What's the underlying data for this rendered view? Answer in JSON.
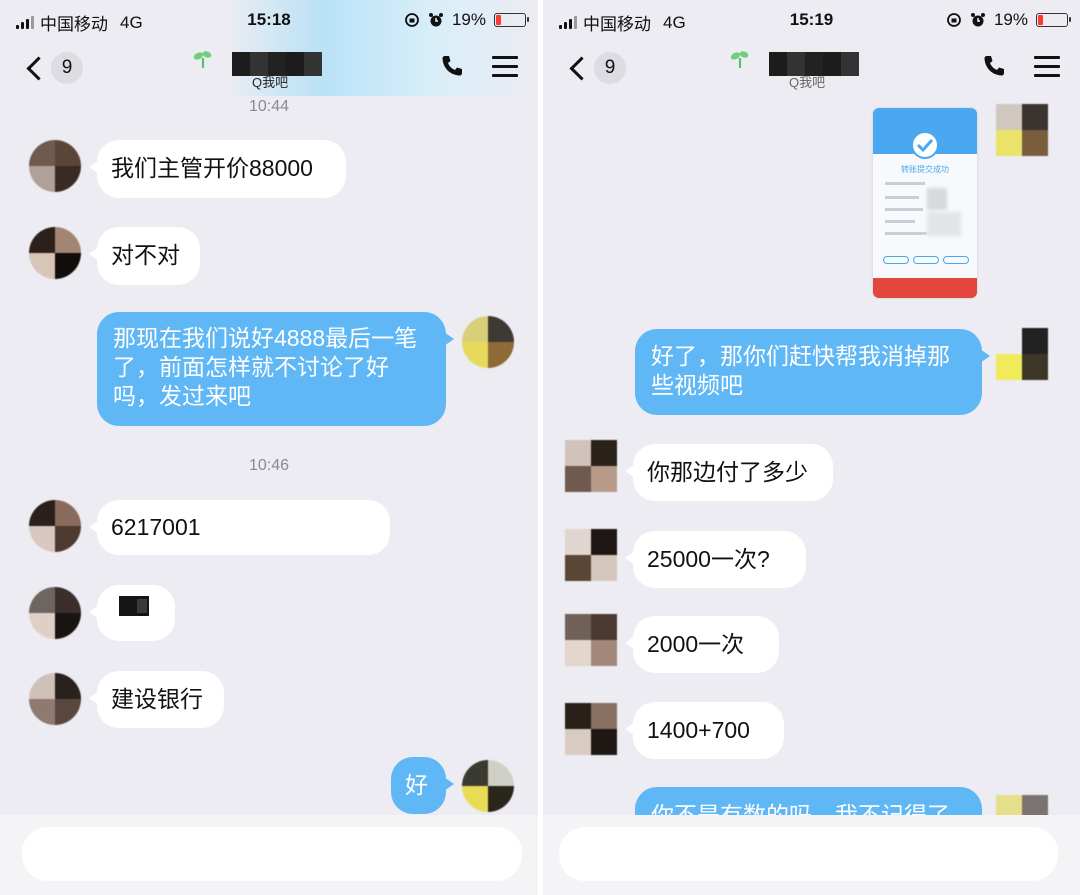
{
  "left": {
    "status": {
      "carrier": "中国移动",
      "network": "4G",
      "time": "15:18",
      "battery": "19%",
      "battery_level": 0.19
    },
    "nav": {
      "unread_count": "9",
      "subtitle": "Q我吧"
    },
    "messages": [
      {
        "kind": "timestamp",
        "text": "10:44"
      },
      {
        "kind": "in",
        "text": "我们主管开价88000"
      },
      {
        "kind": "in",
        "text": "对不对"
      },
      {
        "kind": "out",
        "text": "那现在我们说好4888最后一笔了，前面怎样就不讨论了好吗，发过来吧"
      },
      {
        "kind": "timestamp",
        "text": "10:46"
      },
      {
        "kind": "in",
        "text": "6217001"
      },
      {
        "kind": "in",
        "text": ""
      },
      {
        "kind": "in",
        "text": "建设银行"
      },
      {
        "kind": "out",
        "text": "好"
      }
    ],
    "input_placeholder": ""
  },
  "right": {
    "status": {
      "carrier": "中国移动",
      "network": "4G",
      "time": "15:19",
      "battery": "19%",
      "battery_level": 0.19
    },
    "nav": {
      "unread_count": "9",
      "subtitle": "Q我吧"
    },
    "screenshot_card": {
      "title": "转账提交成功"
    },
    "messages": [
      {
        "kind": "out",
        "text": "好了，那你们赶快帮我消掉那些视频吧"
      },
      {
        "kind": "in",
        "text": "你那边付了多少"
      },
      {
        "kind": "in",
        "text": "25000一次?"
      },
      {
        "kind": "in",
        "text": "2000一次"
      },
      {
        "kind": "in",
        "text": "1400+700"
      },
      {
        "kind": "out",
        "text": "你不是有数的吗，我不记得了"
      }
    ],
    "input_placeholder": ""
  },
  "colors": {
    "outgoing_bubble": "#5fb7f6",
    "incoming_bubble": "#ffffff",
    "chat_bg": "#ececf2",
    "battery_low": "#ff3b30"
  },
  "icons": [
    "signal-icon",
    "orientation-lock-icon",
    "alarm-icon",
    "battery-icon",
    "back-chevron-icon",
    "sprout-icon",
    "phone-call-icon",
    "menu-icon"
  ]
}
